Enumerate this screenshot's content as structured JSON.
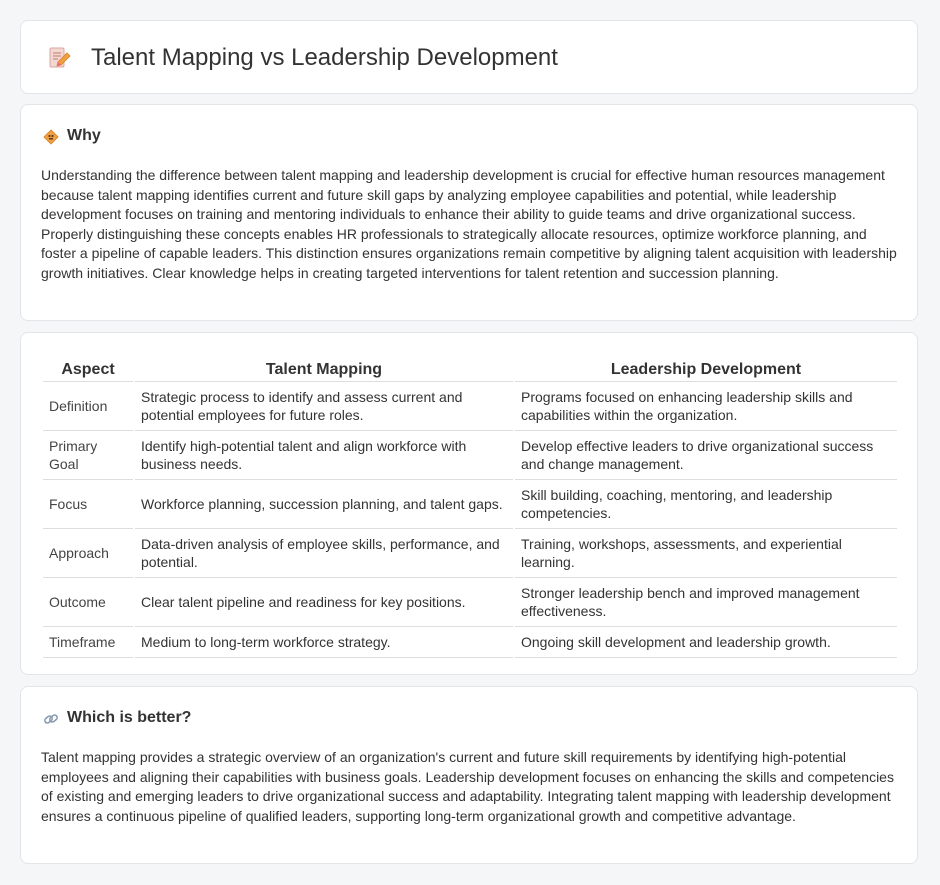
{
  "header": {
    "title": "Talent Mapping vs Leadership Development",
    "icon": "document-pencil-icon"
  },
  "why": {
    "heading": "Why",
    "icon": "diamond-sign-icon",
    "text": "Understanding the difference between talent mapping and leadership development is crucial for effective human resources management because talent mapping identifies current and future skill gaps by analyzing employee capabilities and potential, while leadership development focuses on training and mentoring individuals to enhance their ability to guide teams and drive organizational success. Properly distinguishing these concepts enables HR professionals to strategically allocate resources, optimize workforce planning, and foster a pipeline of capable leaders. This distinction ensures organizations remain competitive by aligning talent acquisition with leadership growth initiatives. Clear knowledge helps in creating targeted interventions for talent retention and succession planning."
  },
  "comparison": {
    "headers": [
      "Aspect",
      "Talent Mapping",
      "Leadership Development"
    ],
    "rows": [
      {
        "aspect": "Definition",
        "a": "Strategic process to identify and assess current and potential employees for future roles.",
        "b": "Programs focused on enhancing leadership skills and capabilities within the organization."
      },
      {
        "aspect": "Primary Goal",
        "a": "Identify high-potential talent and align workforce with business needs.",
        "b": "Develop effective leaders to drive organizational success and change management."
      },
      {
        "aspect": "Focus",
        "a": "Workforce planning, succession planning, and talent gaps.",
        "b": "Skill building, coaching, mentoring, and leadership competencies."
      },
      {
        "aspect": "Approach",
        "a": "Data-driven analysis of employee skills, performance, and potential.",
        "b": "Training, workshops, assessments, and experiential learning."
      },
      {
        "aspect": "Outcome",
        "a": "Clear talent pipeline and readiness for key positions.",
        "b": "Stronger leadership bench and improved management effectiveness."
      },
      {
        "aspect": "Timeframe",
        "a": "Medium to long-term workforce strategy.",
        "b": "Ongoing skill development and leadership growth."
      }
    ]
  },
  "better": {
    "heading": "Which is better?",
    "icon": "link-icon",
    "text": "Talent mapping provides a strategic overview of an organization's current and future skill requirements by identifying high-potential employees and aligning their capabilities with business goals. Leadership development focuses on enhancing the skills and competencies of existing and emerging leaders to drive organizational success and adaptability. Integrating talent mapping with leadership development ensures a continuous pipeline of qualified leaders, supporting long-term organizational growth and competitive advantage."
  },
  "colors": {
    "page_bg": "#f5f6f8",
    "card_bg": "#ffffff",
    "icon_orange": "#f0a040",
    "icon_pink": "#e66a7a"
  }
}
